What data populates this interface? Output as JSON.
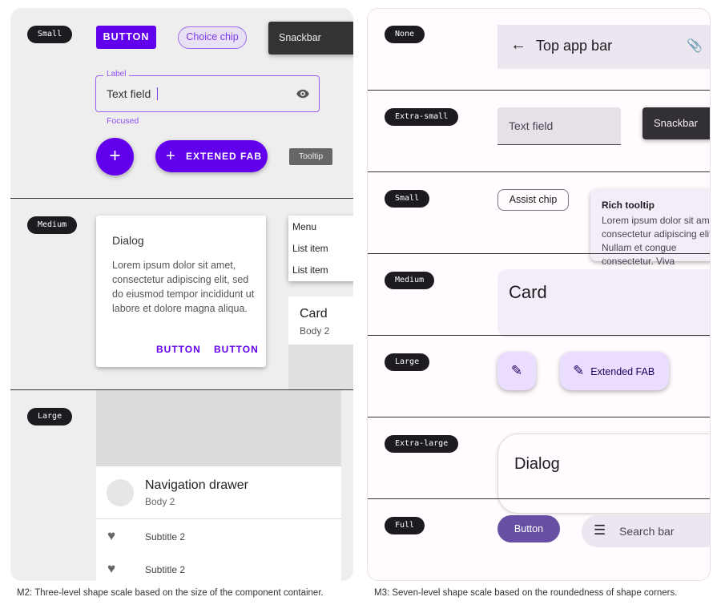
{
  "m2": {
    "levels": [
      "Small",
      "Medium",
      "Large"
    ],
    "button": "BUTTON",
    "choice_chip": "Choice chip",
    "snackbar": "Snackbar",
    "text_field": {
      "label": "Label",
      "value": "Text field",
      "helper": "Focused"
    },
    "fab": "+",
    "extended_fab": "EXTENED FAB",
    "tooltip": "Tooltip",
    "dialog": {
      "title": "Dialog",
      "body": "Lorem ipsum dolor sit amet, consectetur adipiscing elit, sed do eiusmod tempor incididunt ut labore et dolore magna aliqua.",
      "buttons": [
        "BUTTON",
        "BUTTON"
      ]
    },
    "menu": [
      "Menu",
      "List item",
      "List item"
    ],
    "card": {
      "title": "Card",
      "body": "Body 2"
    },
    "drawer": {
      "title": "Navigation drawer",
      "body": "Body 2",
      "items": [
        "Subtitle 2",
        "Subtitle 2"
      ]
    },
    "accent": "#6200ee"
  },
  "m3": {
    "levels": [
      "None",
      "Extra-small",
      "Small",
      "Medium",
      "Large",
      "Extra-large",
      "Full"
    ],
    "top_app_bar": "Top app bar",
    "text_field": "Text field",
    "snackbar": "Snackbar",
    "assist_chip": "Assist chip",
    "rich_tooltip": {
      "title": "Rich tooltip",
      "body": "Lorem ipsum dolor sit amet, consectetur adipiscing elit. Nullam et congue consectetur. Viva"
    },
    "card": "Card",
    "extended_fab": "Extended FAB",
    "dialog": "Dialog",
    "button": "Button",
    "search_bar": "Search bar",
    "accent": "#6750a4"
  },
  "captions": {
    "m2": "M2: Three-level shape scale based on the size of the component container.",
    "m3": "M3: Seven-level shape scale based on the roundedness of shape corners."
  }
}
